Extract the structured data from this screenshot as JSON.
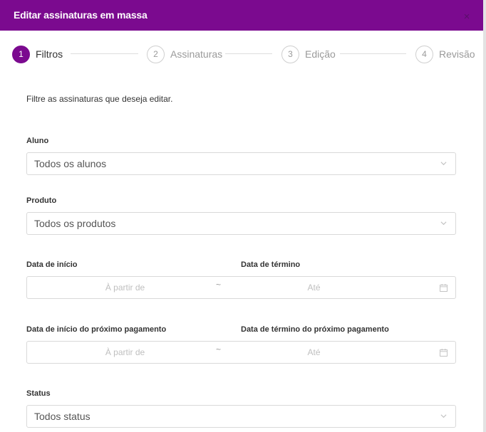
{
  "modal": {
    "title": "Editar assinaturas em massa",
    "close_symbol": "×"
  },
  "steps": [
    {
      "number": "1",
      "label": "Filtros",
      "active": true
    },
    {
      "number": "2",
      "label": "Assinaturas",
      "active": false
    },
    {
      "number": "3",
      "label": "Edição",
      "active": false
    },
    {
      "number": "4",
      "label": "Revisão",
      "active": false
    }
  ],
  "form": {
    "intro": "Filtre as assinaturas que deseja editar.",
    "aluno": {
      "label": "Aluno",
      "value": "Todos os alunos"
    },
    "produto": {
      "label": "Produto",
      "value": "Todos os produtos"
    },
    "datas": {
      "start_label": "Data de início",
      "end_label": "Data de término",
      "start_placeholder": "À partir de",
      "separator": "~",
      "end_placeholder": "Até"
    },
    "pagamento": {
      "start_label": "Data de início do próximo pagamento",
      "end_label": "Data de término do próximo pagamento",
      "start_placeholder": "À partir de",
      "separator": "~",
      "end_placeholder": "Até"
    },
    "status": {
      "label": "Status",
      "value": "Todos status"
    }
  },
  "colors": {
    "accent": "#7b0a8f",
    "border": "#d9d9d9"
  }
}
